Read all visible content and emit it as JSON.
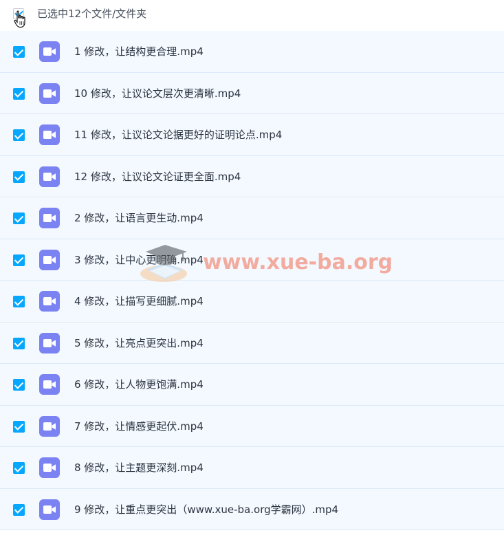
{
  "header": {
    "selection_label": "已选中12个文件/文件夹"
  },
  "files": [
    {
      "name": "1 修改，让结构更合理.mp4"
    },
    {
      "name": "10 修改，让议论文层次更清晰.mp4"
    },
    {
      "name": "11 修改，让议论文论据更好的证明论点.mp4"
    },
    {
      "name": "12 修改，让议论文论证更全面.mp4"
    },
    {
      "name": "2 修改，让语言更生动.mp4"
    },
    {
      "name": "3 修改，让中心更明确.mp4"
    },
    {
      "name": "4 修改，让描写更细腻.mp4"
    },
    {
      "name": "5 修改，让亮点更突出.mp4"
    },
    {
      "name": "6 修改，让人物更饱满.mp4"
    },
    {
      "name": "7 修改，让情感更起伏.mp4"
    },
    {
      "name": "8 修改，让主题更深刻.mp4"
    },
    {
      "name": "9 修改，让重点更突出（www.xue-ba.org学霸网）.mp4"
    }
  ],
  "watermark": {
    "text": "www.xue-ba.org"
  },
  "colors": {
    "checkbox_blue": "#06a7ff",
    "video_icon_purple": "#7b83f2",
    "row_background": "#f4f9ff",
    "row_divider": "#dbe9f8",
    "watermark_color": "#f06e50"
  },
  "icons": {
    "file_icon": "video-file-icon",
    "checkbox": "checkbox-checked-icon",
    "cursor": "hand-pointer-icon"
  }
}
